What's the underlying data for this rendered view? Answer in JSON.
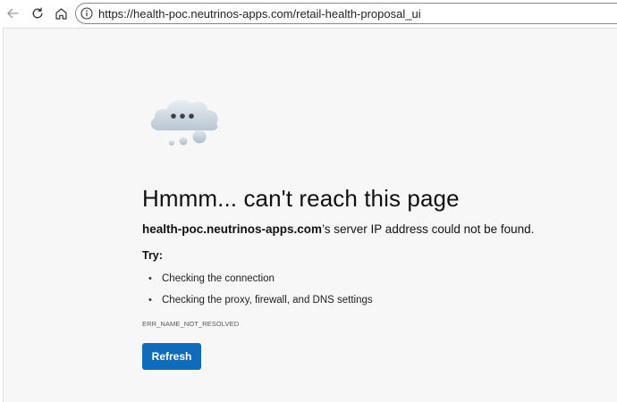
{
  "browser": {
    "url": "https://health-poc.neutrinos-apps.com/retail-health-proposal_ui",
    "icons": [
      "back-arrow-icon",
      "reload-icon",
      "home-icon",
      "site-info-icon"
    ]
  },
  "error_page": {
    "icon": "cloud-icon",
    "title": "Hmmm... can't reach this page",
    "host": "health-poc.neutrinos-apps.com",
    "message_suffix": "’s server IP address could not be found.",
    "try_label": "Try:",
    "suggestions": [
      "Checking the connection",
      "Checking the proxy, firewall, and DNS settings"
    ],
    "error_code": "ERR_NAME_NOT_RESOLVED",
    "refresh_label": "Refresh",
    "colors": {
      "button": "#0f6cbd",
      "background": "#f7f7f7"
    }
  }
}
